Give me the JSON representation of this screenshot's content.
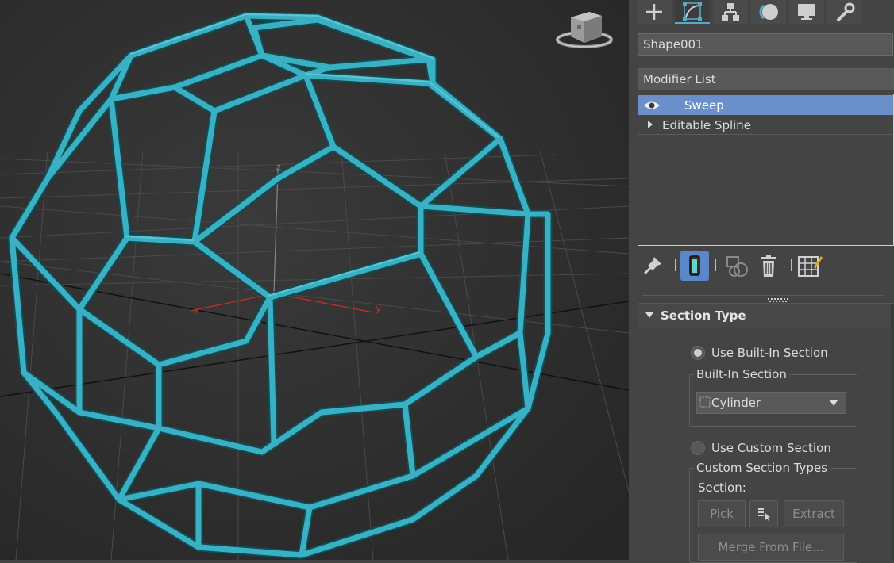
{
  "viewport": {
    "axis_x": "x",
    "axis_y": "y",
    "axis_z": "z",
    "model_color": "#3ab0c2",
    "viewcube_icon": "viewcube-icon"
  },
  "command_panel": {
    "tabs": [
      {
        "name": "create-tab",
        "icon": "plus-icon"
      },
      {
        "name": "modify-tab",
        "icon": "modify-icon"
      },
      {
        "name": "hierarchy-tab",
        "icon": "hierarchy-icon"
      },
      {
        "name": "motion-tab",
        "icon": "motion-icon"
      },
      {
        "name": "display-tab",
        "icon": "monitor-icon"
      },
      {
        "name": "utilities-tab",
        "icon": "wrench-icon"
      }
    ],
    "object_name": "Shape001",
    "modifier_list_label": "Modifier List",
    "stack": [
      {
        "label": "Sweep",
        "selected": true
      },
      {
        "label": "Editable Spline",
        "selected": false
      }
    ],
    "section_type": {
      "title": "Section Type",
      "use_builtin_label": "Use Built-In Section",
      "builtin_group_label": "Built-In Section",
      "builtin_value": "Cylinder",
      "use_custom_label": "Use Custom Section",
      "custom_group_label": "Custom Section Types",
      "section_label": "Section:",
      "pick_label": "Pick",
      "extract_label": "Extract",
      "merge_label": "Merge From File..."
    }
  }
}
